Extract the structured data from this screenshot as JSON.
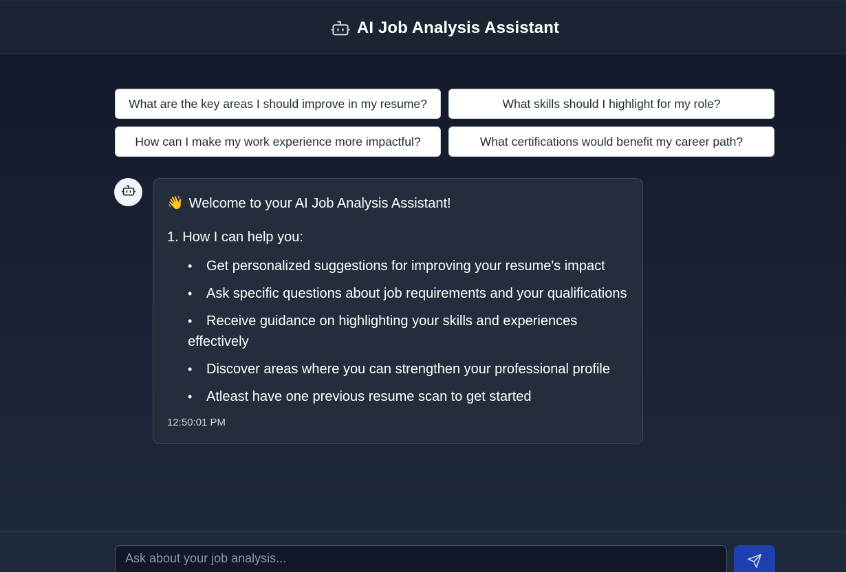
{
  "header": {
    "title": "AI Job Analysis Assistant",
    "logo_icon": "bot-icon"
  },
  "suggestions": [
    "What are the key areas I should improve in my resume?",
    "What skills should I highlight for my role?",
    "How can I make my work experience more impactful?",
    "What certifications would benefit my career path?"
  ],
  "message": {
    "avatar_icon": "bot-icon",
    "wave_emoji": "👋",
    "welcome": "Welcome to your AI Job Analysis Assistant!",
    "section_title": "1. How I can help you:",
    "items": [
      "Get personalized suggestions for improving your resume's impact",
      "Ask specific questions about job requirements and your qualifications",
      "Receive guidance on highlighting your skills and experiences effectively",
      "Discover areas where you can strengthen your professional profile",
      "Atleast have one previous resume scan to get started"
    ],
    "timestamp": "12:50:01 PM"
  },
  "input": {
    "placeholder": "Ask about your job analysis...",
    "value": ""
  },
  "send": {
    "icon": "send-icon"
  },
  "colors": {
    "background": "#111827",
    "header": "#1b2433",
    "bubble": "#232d3c",
    "accent": "#1e40af",
    "suggestion_bg": "#ffffff"
  }
}
